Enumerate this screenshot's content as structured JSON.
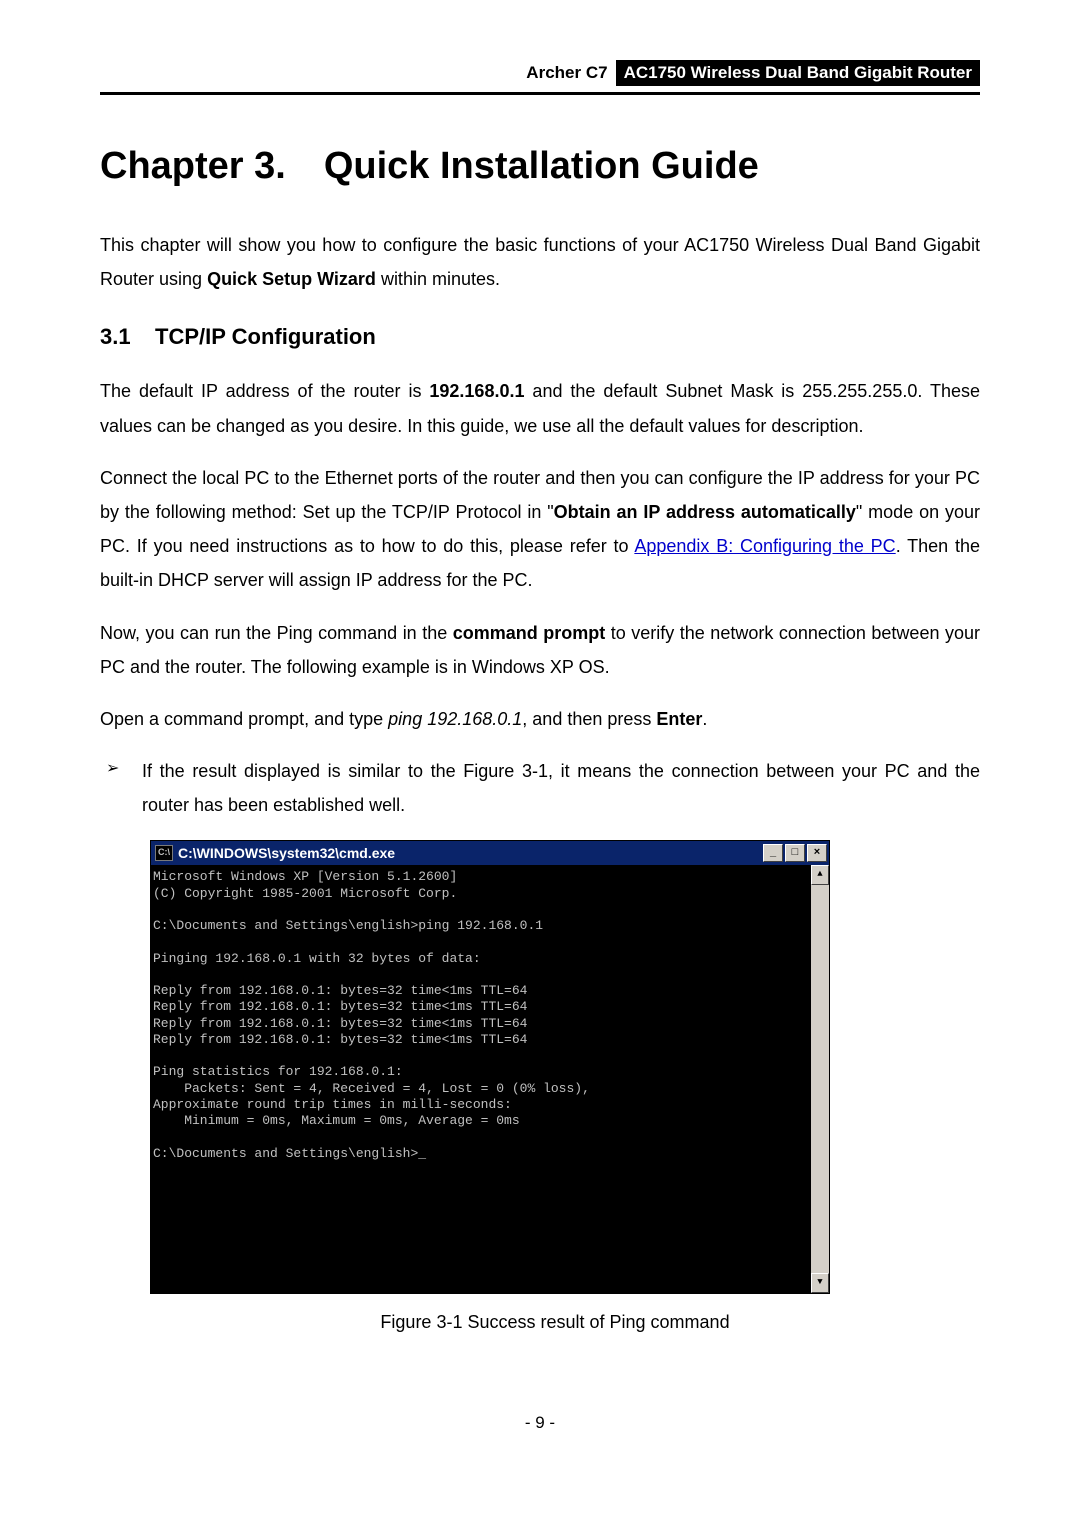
{
  "header": {
    "model": "Archer C7",
    "product_title": "AC1750 Wireless Dual Band Gigabit Router"
  },
  "chapter": {
    "heading": "Chapter 3. Quick Installation Guide"
  },
  "intro": {
    "pre": "This chapter will show you how to configure the basic functions of your  AC1750 Wireless Dual Band Gigabit Router using ",
    "bold": "Quick Setup Wizard",
    "post": " within minutes."
  },
  "section": {
    "number": "3.1",
    "title": "TCP/IP Configuration"
  },
  "para1": {
    "pre": "The default IP address of the router is ",
    "ip": "192.168.0.1",
    "post": " and the default Subnet Mask is 255.255.255.0. These values can be changed as you desire. In this guide, we use all the default values for description."
  },
  "para2": {
    "seg1": "Connect the local PC to the Ethernet ports of the router and then you can configure the IP address for your PC by the following method: Set up the TCP/IP Protocol in \"",
    "bold1": "Obtain an IP address automatically",
    "seg2": "\" mode on your PC. If you need instructions as to how to do this, please refer to ",
    "link": "Appendix B: Configuring the PC",
    "seg3": ". Then the built-in DHCP server will assign IP address for the PC."
  },
  "para3": {
    "seg1": "Now, you can run the Ping command in the ",
    "bold1": "command prompt",
    "seg2": " to verify the network connection between your PC and the router. The following example is in Windows XP OS."
  },
  "para4": {
    "seg1": "Open a command prompt, and type ",
    "italic": "ping 192.168.0.1",
    "seg2": ", and then press ",
    "bold": "Enter",
    "seg3": "."
  },
  "bullet1": "If the result displayed is similar to the Figure 3-1, it means the connection between your PC and the router has been established well.",
  "cmd": {
    "sysicon_label": "C:\\",
    "title": "C:\\WINDOWS\\system32\\cmd.exe",
    "btn_min": "_",
    "btn_max": "□",
    "btn_close": "×",
    "scroll_up": "▲",
    "scroll_down": "▼",
    "output": "Microsoft Windows XP [Version 5.1.2600]\n(C) Copyright 1985-2001 Microsoft Corp.\n\nC:\\Documents and Settings\\english>ping 192.168.0.1\n\nPinging 192.168.0.1 with 32 bytes of data:\n\nReply from 192.168.0.1: bytes=32 time<1ms TTL=64\nReply from 192.168.0.1: bytes=32 time<1ms TTL=64\nReply from 192.168.0.1: bytes=32 time<1ms TTL=64\nReply from 192.168.0.1: bytes=32 time<1ms TTL=64\n\nPing statistics for 192.168.0.1:\n    Packets: Sent = 4, Received = 4, Lost = 0 (0% loss),\nApproximate round trip times in milli-seconds:\n    Minimum = 0ms, Maximum = 0ms, Average = 0ms\n\nC:\\Documents and Settings\\english>_\n\n\n\n\n"
  },
  "figure_caption": "Figure 3-1 Success result of Ping command",
  "page_number": "- 9 -"
}
